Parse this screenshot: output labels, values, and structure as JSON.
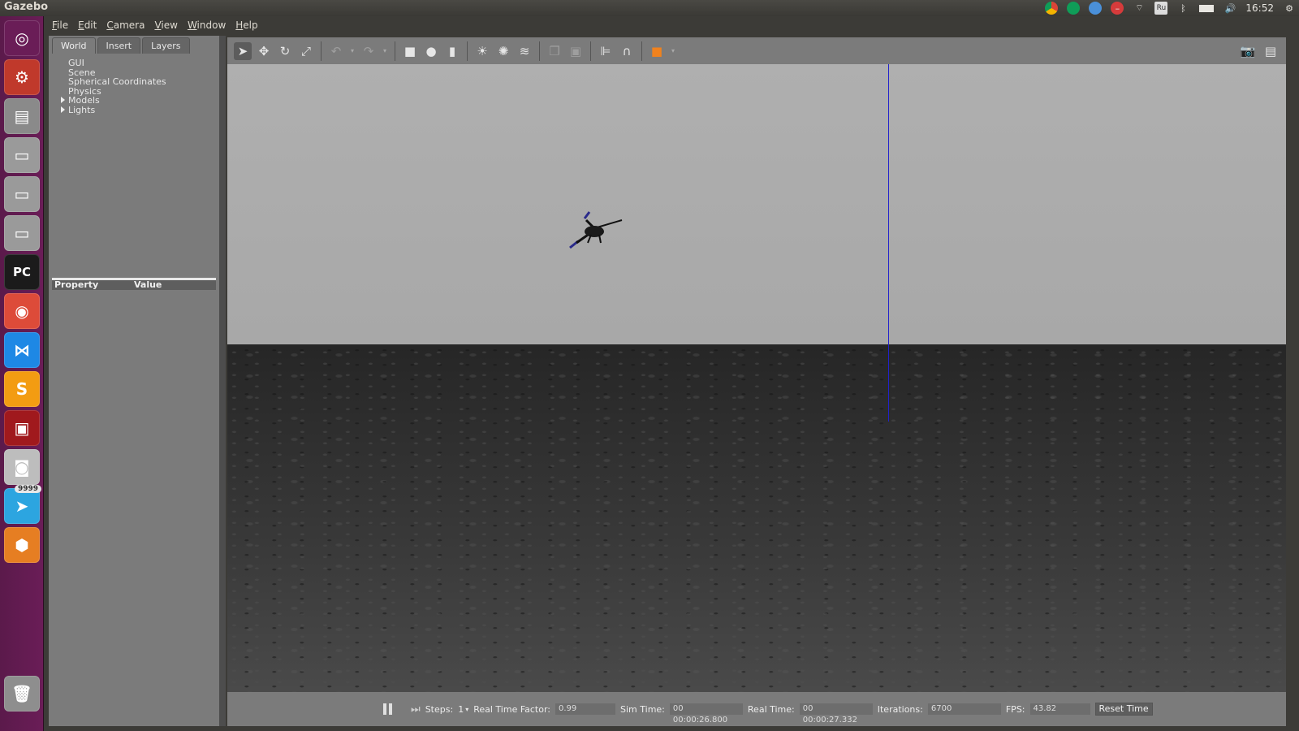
{
  "window": {
    "title": "Gazebo"
  },
  "tray": {
    "keyboard_layout": "Ru",
    "clock": "16:52",
    "icons": [
      "chrome-icon",
      "hangouts-icon",
      "update-icon",
      "do-not-disturb-icon",
      "wifi-icon",
      "keyboard-layout-icon",
      "bluetooth-icon",
      "battery-icon",
      "volume-icon",
      "clock",
      "settings-gear-icon"
    ]
  },
  "launcher": {
    "items": [
      {
        "name": "ubuntu-dash-icon",
        "glyph": "◎",
        "color": "#6a1d57"
      },
      {
        "name": "system-settings-icon",
        "glyph": "⚙",
        "color": "#c0392b"
      },
      {
        "name": "files-icon",
        "glyph": "▤",
        "color": "#8a8a8a"
      },
      {
        "name": "drive-icon",
        "glyph": "▭",
        "color": "#9a9a9a"
      },
      {
        "name": "drive-icon",
        "glyph": "▭",
        "color": "#9a9a9a"
      },
      {
        "name": "drive-icon",
        "glyph": "▭",
        "color": "#9a9a9a"
      },
      {
        "name": "pycharm-icon",
        "glyph": "PC",
        "color": "#1b1b1b"
      },
      {
        "name": "chrome-icon",
        "glyph": "◉",
        "color": "#dd4b39"
      },
      {
        "name": "vscode-icon",
        "glyph": "⋈",
        "color": "#1e88e5"
      },
      {
        "name": "sublime-icon",
        "glyph": "S",
        "color": "#f39c12"
      },
      {
        "name": "terminal-icon",
        "glyph": "▣",
        "color": "#a0191d"
      },
      {
        "name": "camera-icon",
        "glyph": "◙",
        "color": "#bdbdbd"
      },
      {
        "name": "telegram-icon",
        "glyph": "➤",
        "color": "#2ca5e0",
        "badge": "9999"
      },
      {
        "name": "gazebo-icon",
        "glyph": "⬢",
        "color": "#e67e22"
      }
    ],
    "trash": {
      "name": "trash-icon",
      "glyph": "🗑"
    }
  },
  "menubar": {
    "items": [
      {
        "label": "File",
        "key": "F",
        "rest": "ile"
      },
      {
        "label": "Edit",
        "key": "E",
        "rest": "dit"
      },
      {
        "label": "Camera",
        "key": "C",
        "rest": "amera"
      },
      {
        "label": "View",
        "key": "V",
        "rest": "iew"
      },
      {
        "label": "Window",
        "key": "W",
        "rest": "indow"
      },
      {
        "label": "Help",
        "key": "H",
        "rest": "elp"
      }
    ]
  },
  "left_panel": {
    "tabs": [
      "World",
      "Insert",
      "Layers"
    ],
    "active_tab": "World",
    "tree": [
      "GUI",
      "Scene",
      "Spherical Coordinates",
      "Physics",
      "Models",
      "Lights"
    ],
    "property_header": {
      "property": "Property",
      "value": "Value"
    }
  },
  "toolbar": {
    "buttons": [
      "select-arrow-icon",
      "translate-icon",
      "rotate-icon",
      "scale-icon",
      "undo-icon",
      "redo-icon",
      "box-icon",
      "sphere-icon",
      "cylinder-icon",
      "point-light-icon",
      "spot-light-icon",
      "directional-light-icon",
      "copy-icon",
      "paste-icon",
      "align-icon",
      "snap-icon",
      "view-angle-icon",
      "screenshot-icon",
      "log-icon"
    ]
  },
  "bottom_bar": {
    "steps_label": "Steps:",
    "steps_value": "1",
    "rtf_label": "Real Time Factor:",
    "rtf_value": "0.99",
    "sim_time_label": "Sim Time:",
    "sim_time_value": "00 00:00:26.800",
    "real_time_label": "Real Time:",
    "real_time_value": "00 00:00:27.332",
    "iterations_label": "Iterations:",
    "iterations_value": "6700",
    "fps_label": "FPS:",
    "fps_value": "43.82",
    "reset_label": "Reset Time"
  }
}
